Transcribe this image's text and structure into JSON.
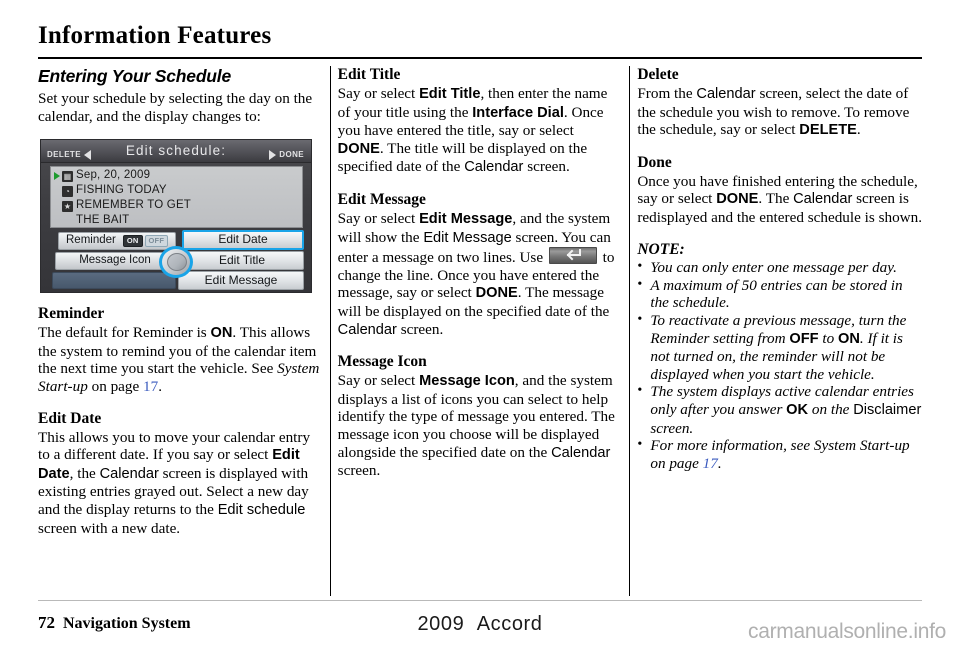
{
  "page_title": "Information Features",
  "column1": {
    "heading": "Entering Your Schedule",
    "intro": "Set your schedule by selecting the day on the calendar, and the display changes to:",
    "nav_screen": {
      "title": "Edit schedule:",
      "delete_button": "DELETE",
      "done_button": "DONE",
      "list": [
        {
          "icon": "calendar-icon",
          "icon_glyph": "▦",
          "text": "Sep, 20, 2009",
          "selected": true
        },
        {
          "icon": "clock-icon",
          "icon_glyph": "◔",
          "text": "FISHING TODAY",
          "selected": false
        },
        {
          "icon": "star-icon",
          "icon_glyph": "★",
          "text": "REMEMBER TO GET",
          "selected": false
        },
        {
          "icon": "none",
          "icon_glyph": "",
          "text": "THE BAIT",
          "selected": false,
          "continuation": true
        }
      ],
      "reminder_label": "Reminder",
      "reminder_on": "ON",
      "reminder_off": "OFF",
      "reminder_state": "ON",
      "message_icon_label": "Message Icon",
      "edit_date_label": "Edit Date",
      "edit_title_label": "Edit Title",
      "edit_message_label": "Edit Message",
      "highlight_color": "#19a4e8",
      "cursor_color": "#1d9b2e"
    },
    "reminder": {
      "heading": "Reminder",
      "text_1": "The default for Reminder is ",
      "bold_1": "ON",
      "text_2": ". This allows the system to remind you of the calendar item the next time you start the vehicle. See ",
      "italic_1": "System Start-up",
      "text_3": " on page ",
      "page_ref": "17",
      "text_4": "."
    },
    "edit_date": {
      "heading": "Edit Date",
      "text_1": "This allows you to move your calendar entry to a different date. If you say or select ",
      "bold_1": "Edit Date",
      "text_2": ", the ",
      "sans_1": "Calendar",
      "text_3": " screen is displayed with existing entries grayed out. Select a new day and the display returns to the ",
      "sans_2": "Edit schedule",
      "text_4": " screen with a new date."
    }
  },
  "column2": {
    "edit_title": {
      "heading": "Edit Title",
      "text_1": "Say or select ",
      "bold_1": "Edit Title",
      "text_2": ", then enter the name of your title using the ",
      "bold_2": "Interface Dial",
      "text_3": ". Once you have entered the title, say or select ",
      "bold_3": "DONE",
      "text_4": ". The title will be displayed on the specified date of the ",
      "sans_1": "Calendar",
      "text_5": " screen."
    },
    "edit_message": {
      "heading": "Edit Message",
      "text_1": "Say or select ",
      "bold_1": "Edit Message",
      "text_2": ", and the system will show the ",
      "sans_1": "Edit Message",
      "text_3": " screen. You can enter a message on two lines. Use ",
      "key_icon": "enter-key-icon",
      "text_4": " to change the line. Once you have entered the message, say or select ",
      "bold_2": "DONE",
      "text_5": ". The message will be displayed on the specified date of the ",
      "sans_2": "Calendar",
      "text_6": " screen."
    },
    "message_icon": {
      "heading": "Message Icon",
      "text_1": "Say or select ",
      "bold_1": "Message Icon",
      "text_2": ", and the system displays a list of icons you can select to help identify the type of message you entered. The message icon you choose will be displayed alongside the specified date on the ",
      "sans_1": "Calendar",
      "text_3": " screen."
    }
  },
  "column3": {
    "delete": {
      "heading": "Delete",
      "text_1": "From the ",
      "sans_1": "Calendar",
      "text_2": " screen, select the date of the schedule you wish to remove. To remove the schedule, say or select ",
      "bold_1": "DELETE",
      "text_3": "."
    },
    "done": {
      "heading": "Done",
      "text_1": "Once you have finished entering the schedule, say or select ",
      "bold_1": "DONE",
      "text_2": ". The ",
      "sans_1": "Calendar",
      "text_3": " screen is redisplayed and the entered schedule is shown."
    },
    "note_heading": "NOTE:",
    "notes": [
      {
        "parts": [
          {
            "type": "italic",
            "text": "You can only enter one message per day."
          }
        ]
      },
      {
        "parts": [
          {
            "type": "italic",
            "text": "A maximum of 50 entries can be stored in the schedule."
          }
        ]
      },
      {
        "parts": [
          {
            "type": "italic",
            "text": "To reactivate a previous message, turn the Reminder setting from "
          },
          {
            "type": "bold-sans",
            "text": "OFF"
          },
          {
            "type": "italic",
            "text": " to "
          },
          {
            "type": "bold-sans",
            "text": "ON"
          },
          {
            "type": "italic",
            "text": ". If it is not turned on, the reminder will not be displayed when you start the vehicle."
          }
        ]
      },
      {
        "parts": [
          {
            "type": "italic",
            "text": "The system displays active calendar entries only after you answer "
          },
          {
            "type": "bold-sans",
            "text": "OK"
          },
          {
            "type": "italic",
            "text": " on the "
          },
          {
            "type": "sans",
            "text": "Disclaimer"
          },
          {
            "type": "italic",
            "text": " screen."
          }
        ]
      },
      {
        "parts": [
          {
            "type": "italic",
            "text": "For more information, see "
          },
          {
            "type": "roman",
            "text": "System Start-up"
          },
          {
            "type": "italic",
            "text": " on page "
          },
          {
            "type": "pageref",
            "text": "17"
          },
          {
            "type": "italic",
            "text": "."
          }
        ]
      }
    ]
  },
  "footer": {
    "page_number": "72",
    "section_name": "Navigation System",
    "model_year": "2009",
    "model_name": "Accord",
    "watermark": "carmanualsonline.info"
  }
}
